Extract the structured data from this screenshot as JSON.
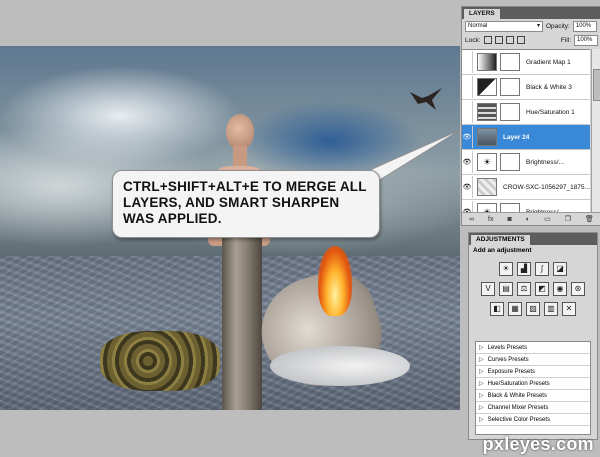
{
  "callout": {
    "text": "CTRL+SHIFT+ALT+E TO MERGE ALL LAYERS, AND SMART SHARPEN WAS APPLIED."
  },
  "layers_panel": {
    "tab": "LAYERS",
    "blend_mode": "Normal",
    "opacity_label": "Opacity:",
    "opacity_value": "100%",
    "lock_label": "Lock:",
    "fill_label": "Fill:",
    "fill_value": "100%",
    "layers": [
      {
        "name": "Gradient Map 1",
        "selected": false,
        "visible": false
      },
      {
        "name": "Black & White 3",
        "selected": false,
        "visible": false
      },
      {
        "name": "Hue/Saturation 1",
        "selected": false,
        "visible": false
      },
      {
        "name": "Layer 24",
        "selected": true,
        "visible": true
      },
      {
        "name": "Brightness/...",
        "selected": false,
        "visible": true
      },
      {
        "name": "CROW-SXC-1056297_1875...",
        "selected": false,
        "visible": true
      },
      {
        "name": "Brightness/...",
        "selected": false,
        "visible": true
      }
    ]
  },
  "adjustments_panel": {
    "tab": "ADJUSTMENTS",
    "title": "Add an adjustment",
    "presets": [
      "Levels Presets",
      "Curves Presets",
      "Exposure Presets",
      "Hue/Saturation Presets",
      "Black & White Presets",
      "Channel Mixer Presets",
      "Selective Color Presets"
    ]
  },
  "watermark": "pxleyes.com",
  "colors": {
    "selected_layer": "#3a88d8",
    "panel_bg": "#d6d6d6"
  }
}
